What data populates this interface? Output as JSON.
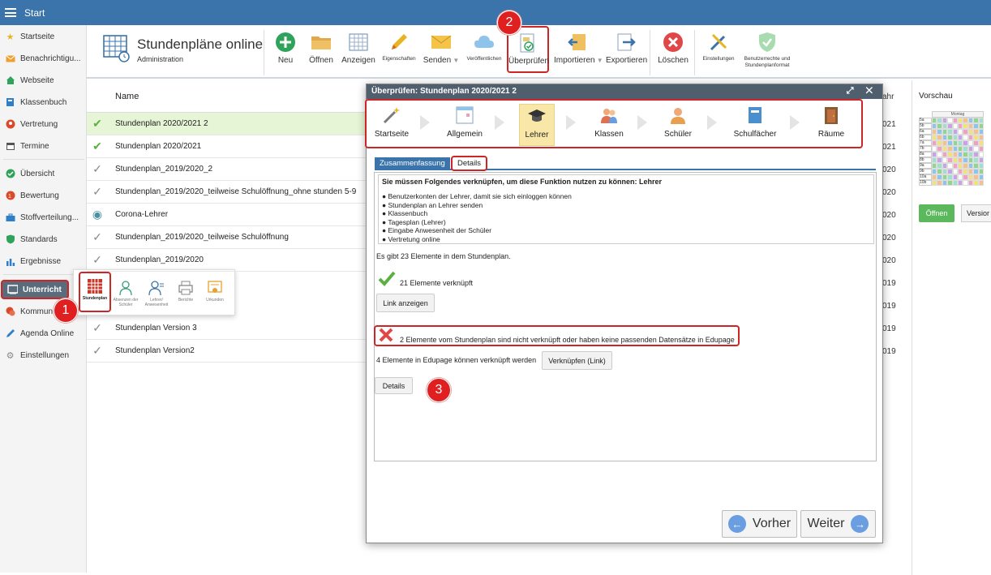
{
  "topbar": {
    "title": "Start"
  },
  "sidebar": {
    "items": [
      {
        "label": "Startseite",
        "icon": "star-icon",
        "color": "#e8b422"
      },
      {
        "label": "Benachrichtigu...",
        "icon": "envelope-icon",
        "color": "#f0a030"
      },
      {
        "label": "Webseite",
        "icon": "home-icon",
        "color": "#2fa35c"
      },
      {
        "label": "Klassenbuch",
        "icon": "book-icon",
        "color": "#2f7ec9"
      },
      {
        "label": "Vertretung",
        "icon": "user-icon",
        "color": "#d84a2a"
      },
      {
        "label": "Termine",
        "icon": "calendar-icon",
        "color": "#555555"
      },
      {
        "label": "Übersicht",
        "icon": "check-circle-icon",
        "color": "#2fa35c"
      },
      {
        "label": "Bewertung",
        "icon": "grade-icon",
        "color": "#d84a2a"
      },
      {
        "label": "Stoffverteilung...",
        "icon": "briefcase-icon",
        "color": "#2f7ec9"
      },
      {
        "label": "Standards",
        "icon": "shield-icon",
        "color": "#2fa35c"
      },
      {
        "label": "Ergebnisse",
        "icon": "bar-chart-icon",
        "color": "#2f7ec9"
      },
      {
        "label": "Unterricht",
        "icon": "classroom-icon",
        "color": "#ffffff"
      },
      {
        "label": "Kommunik",
        "icon": "chat-icon",
        "color": "#d84a2a"
      },
      {
        "label": "Agenda Online",
        "icon": "pen-icon",
        "color": "#2f7ec9"
      },
      {
        "label": "Einstellungen",
        "icon": "gear-icon",
        "color": "#888888"
      }
    ]
  },
  "flyout": {
    "items": [
      {
        "label": "Stundenplan",
        "icon": "timetable-icon"
      },
      {
        "label": "Absenzen der Schüler",
        "icon": "student-icon"
      },
      {
        "label": "Lehrer/ Anwesenheit",
        "icon": "teacher-icon"
      },
      {
        "label": "Berichte",
        "icon": "printer-icon"
      },
      {
        "label": "Urkunden",
        "icon": "certificate-icon"
      }
    ]
  },
  "app": {
    "title": "Stundenpläne online",
    "subtitle": "Administration"
  },
  "toolbar": [
    {
      "label": "Neu",
      "icon": "plus-circle-icon"
    },
    {
      "label": "Öffnen",
      "icon": "folder-icon"
    },
    {
      "label": "Anzeigen",
      "icon": "grid-icon"
    },
    {
      "label": "Eigenschaften",
      "icon": "pencil-icon"
    },
    {
      "label": "Senden",
      "icon": "envelope-icon"
    },
    {
      "label": "Veröffentlichen",
      "icon": "cloud-icon"
    },
    {
      "label": "Überprüfen",
      "icon": "check-doc-icon"
    },
    {
      "label": "Importieren",
      "icon": "import-icon"
    },
    {
      "label": "Exportieren",
      "icon": "export-icon"
    },
    {
      "label": "Löschen",
      "icon": "delete-icon"
    },
    {
      "label": "Einstellungen",
      "icon": "tools-icon"
    },
    {
      "label": "Benutzerrechte und Stundenplanformat",
      "icon": "shield-check-icon"
    }
  ],
  "list": {
    "header": "Name",
    "year_header": "ahr",
    "rows": [
      {
        "name": "Stundenplan 2020/2021 2",
        "year": "021",
        "check": "✔"
      },
      {
        "name": "Stundenplan 2020/2021",
        "year": "021",
        "check": "✔"
      },
      {
        "name": "Stundenplan_2019/2020_2",
        "year": "020",
        "check": "✓"
      },
      {
        "name": "Stundenplan_2019/2020_teilweise Schulöffnung_ohne stunden 5-9",
        "year": "020",
        "check": "✓"
      },
      {
        "name": "Corona-Lehrer",
        "year": "020",
        "check": "◉"
      },
      {
        "name": "Stundenplan_2019/2020_teilweise Schulöffnung",
        "year": "020",
        "check": "✓"
      },
      {
        "name": "Stundenplan_2019/2020",
        "year": "020",
        "check": "✓"
      },
      {
        "name": "",
        "year": "019",
        "check": ""
      },
      {
        "name": "",
        "year": "019",
        "check": ""
      },
      {
        "name": "Stundenplan Version 3",
        "year": "019",
        "check": "✓"
      },
      {
        "name": "Stundenplan Version2",
        "year": "019",
        "check": "✓"
      }
    ]
  },
  "preview": {
    "title": "Vorschau",
    "day": "Montag",
    "rows": [
      "5a",
      "5b",
      "6a",
      "6b",
      "7a",
      "7b",
      "8a",
      "8b",
      "9a",
      "9b",
      "10a",
      "10b"
    ],
    "open_label": "Öffnen",
    "version_label": "Versior"
  },
  "dialog": {
    "title": "Überprüfen: Stundenplan 2020/2021 2",
    "controls": "⤢ ✕",
    "steps": [
      {
        "label": "Startseite",
        "icon": "wand-icon"
      },
      {
        "label": "Allgemein",
        "icon": "calendar-grid-icon"
      },
      {
        "label": "Lehrer",
        "icon": "graduation-cap-icon"
      },
      {
        "label": "Klassen",
        "icon": "group-icon"
      },
      {
        "label": "Schüler",
        "icon": "person-icon"
      },
      {
        "label": "Schulfächer",
        "icon": "notebook-icon"
      },
      {
        "label": "Räume",
        "icon": "door-icon"
      }
    ],
    "tabs": {
      "summary": "Zusammenfassung",
      "details": "Details"
    },
    "requirement_title": "Sie müssen Folgendes verknüpfen, um diese Funktion nutzen zu können: Lehrer",
    "requirements": [
      "Benutzerkonten der Lehrer, damit sie sich einloggen können",
      "Stundenplan an Lehrer senden",
      "Klassenbuch",
      "Tagesplan (Lehrer)",
      "Eingabe Anwesenheit der Schüler",
      "Vertretung online"
    ],
    "elements_count": "Es gibt 23 Elemente in dem Stundenplan.",
    "linked": "21 Elemente verknüpft",
    "show_link": "Link anzeigen",
    "not_linked": "2 Elemente vom Stundenplan sind nicht verknüpft oder haben keine passenden Datensätze in Edupage",
    "can_link": "4 Elemente in Edupage können verknüpft werden",
    "link_btn": "Verknüpfen (Link)",
    "details_btn": "Details",
    "prev": "Vorher",
    "next": "Weiter"
  },
  "badges": [
    "1",
    "2",
    "3"
  ],
  "colors": {
    "topbar": "#3a74ab",
    "highlight": "#d02525",
    "badge": "#e02020",
    "selected_row": "#e6f5d6",
    "dialog_title": "#505f6e"
  }
}
